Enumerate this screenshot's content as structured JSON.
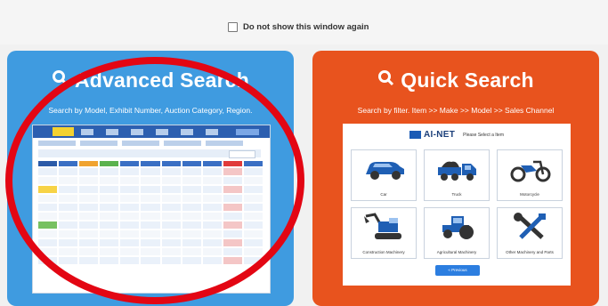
{
  "dont_show": {
    "label": "Do not show this window again",
    "checked": false
  },
  "advanced": {
    "title": "Advanced Search",
    "subtitle": "Search by Model, Exhibit Number, Auction Category, Region.",
    "accent": "#3f9be0"
  },
  "quick": {
    "title": "Quick Search",
    "subtitle": "Search by filter. Item >> Make >> Model >> Sales Channel",
    "accent": "#e8531e",
    "logo_text": "AI-NET",
    "select_text": "Please Select a Item",
    "items": [
      {
        "label": "Car",
        "icon": "car-icon"
      },
      {
        "label": "Truck",
        "icon": "truck-icon"
      },
      {
        "label": "Motorcycle",
        "icon": "motorcycle-icon"
      },
      {
        "label": "Construction Machinery",
        "icon": "excavator-icon"
      },
      {
        "label": "Agricultural Machinery",
        "icon": "tractor-icon"
      },
      {
        "label": "Other Machinery and Parts",
        "icon": "tools-icon"
      }
    ],
    "previous_label": "« Previous"
  },
  "annotation_color": "#e30613"
}
